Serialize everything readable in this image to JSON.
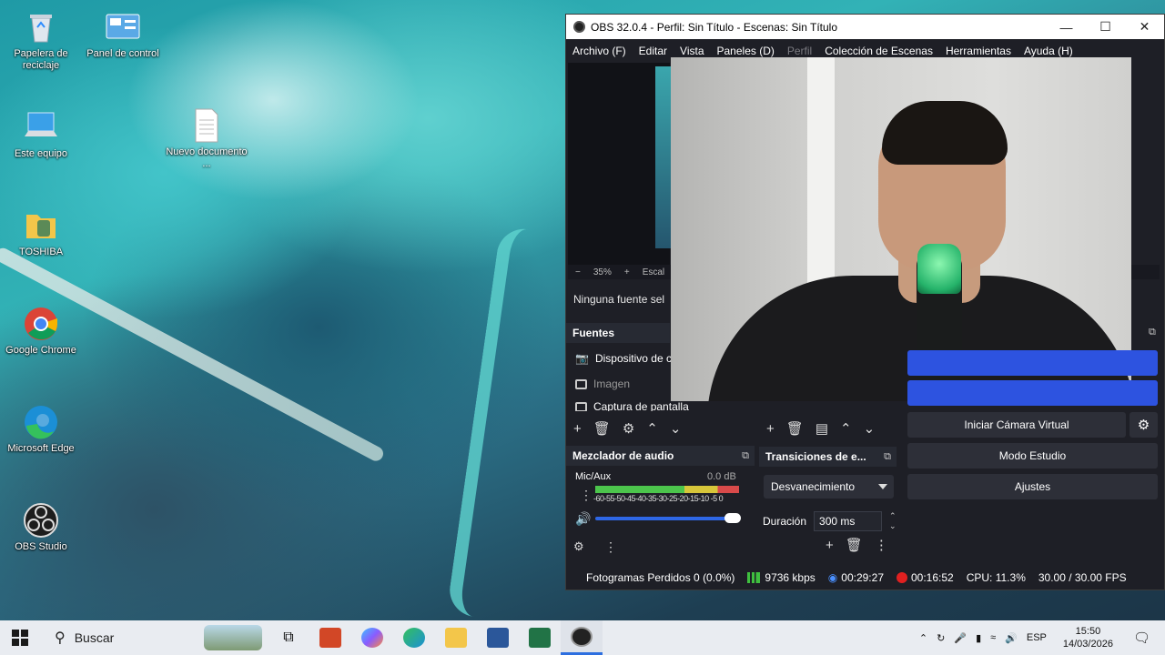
{
  "desktop": {
    "icons": [
      {
        "label": "Papelera de reciclaje",
        "icon": "recycle-bin-icon"
      },
      {
        "label": "Panel de control",
        "icon": "control-panel-icon"
      },
      {
        "label": "Este equipo",
        "icon": "computer-icon"
      },
      {
        "label": "Nuevo documento ...",
        "icon": "text-document-icon"
      },
      {
        "label": "TOSHIBA",
        "icon": "folder-icon"
      },
      {
        "label": "Google Chrome",
        "icon": "chrome-icon"
      },
      {
        "label": "Microsoft Edge",
        "icon": "edge-icon"
      },
      {
        "label": "OBS Studio",
        "icon": "obs-icon"
      }
    ]
  },
  "obs": {
    "title": "OBS 32.0.4 - Perfil: Sin Título - Escenas: Sin Título",
    "menu": [
      "Archivo (F)",
      "Editar",
      "Vista",
      "Paneles (D)",
      "Perfil",
      "Colección de Escenas",
      "Herramientas",
      "Ayuda (H)"
    ],
    "zoom": {
      "minus": "−",
      "value": "35%",
      "plus": "+",
      "scale_label": "Escal"
    },
    "no_source": "Ninguna fuente sel",
    "sources": {
      "title": "Fuentes",
      "items": [
        "Dispositivo de c",
        "Imagen",
        "Captura de pantalla"
      ]
    },
    "audio_mixer": {
      "title": "Mezclador de audio",
      "channel": "Mic/Aux",
      "level": "0.0 dB",
      "ticks": "-60-55-50-45-40-35-30-25-20-15-10 -5  0",
      "volume_fraction": 1.0
    },
    "transitions": {
      "title": "Transiciones de e...",
      "selected": "Desvanecimiento",
      "duration_label": "Duración",
      "duration_value": "300 ms"
    },
    "controls": {
      "virtual_cam": "Iniciar Cámara Virtual",
      "studio_mode": "Modo Estudio",
      "settings": "Ajustes"
    },
    "status": {
      "dropped_frames": "Fotogramas Perdidos 0 (0.0%)",
      "bitrate": "9736 kbps",
      "stream_time": "00:29:27",
      "rec_time": "00:16:52",
      "cpu": "CPU: 11.3%",
      "fps": "30.00 / 30.00 FPS"
    },
    "colors": {
      "accent": "#2d53e0",
      "background": "#1e1f26",
      "recording": "#e02020"
    }
  },
  "taskbar": {
    "search_placeholder": "Buscar",
    "apps": [
      "task-view-icon",
      "powerpoint-icon",
      "copilot-icon",
      "edge-icon",
      "file-explorer-icon",
      "word-icon",
      "excel-icon",
      "obs-icon"
    ],
    "language": "ESP",
    "time": "15:50",
    "date": "14/03/2026"
  }
}
